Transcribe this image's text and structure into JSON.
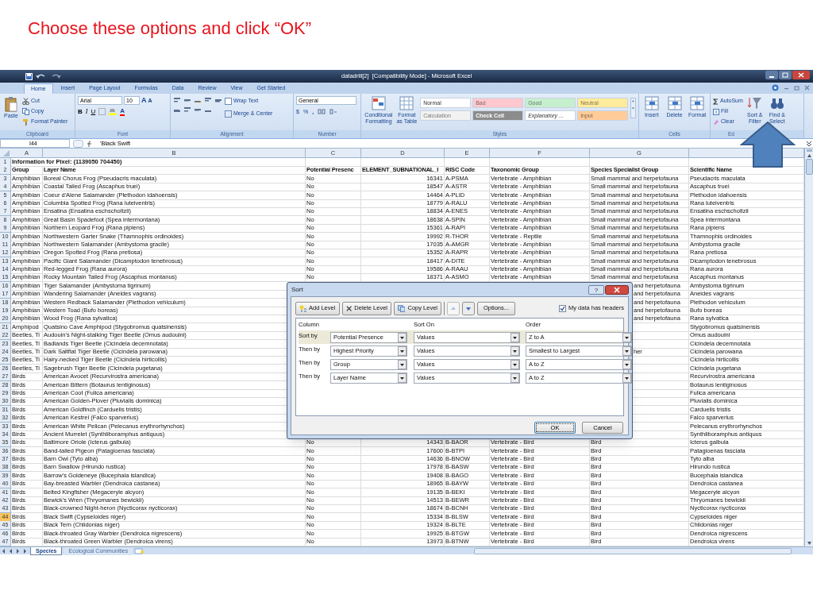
{
  "slide_title": "Choose these options and click “OK”",
  "window": {
    "title": "datadrill[2]  [Compatibility Mode] - Microsoft Excel"
  },
  "ribbon_tabs": [
    {
      "label": "Home",
      "selected": true
    },
    {
      "label": "Insert",
      "selected": false
    },
    {
      "label": "Page Layout",
      "selected": false
    },
    {
      "label": "Formulas",
      "selected": false
    },
    {
      "label": "Data",
      "selected": false
    },
    {
      "label": "Review",
      "selected": false
    },
    {
      "label": "View",
      "selected": false
    },
    {
      "label": "Get Started",
      "selected": false
    }
  ],
  "ribbon": {
    "clipboard": {
      "label": "Clipboard",
      "paste": "Paste",
      "cut": "Cut",
      "copy": "Copy",
      "format_painter": "Format Painter"
    },
    "font": {
      "label": "Font",
      "font_name": "Arial",
      "font_size": "10",
      "grow": "A",
      "shrink": "A",
      "bold": "B",
      "italic": "I",
      "underline": "U",
      "font_color": "A"
    },
    "alignment": {
      "label": "Alignment",
      "wrap_text": "Wrap Text",
      "merge_center": "Merge & Center"
    },
    "number": {
      "label": "Number",
      "format": "General",
      "currency": "$",
      "percent": "%",
      "comma": ","
    },
    "styles": {
      "label": "Styles",
      "conditional_formatting": "Conditional Formatting",
      "format_as_table": "Format as Table",
      "cell_styles": [
        {
          "label": "Normal",
          "color": "#ffffff"
        },
        {
          "label": "Bad",
          "color": "#ffc7ce"
        },
        {
          "label": "Good",
          "color": "#c6efce"
        },
        {
          "label": "Neutral",
          "color": "#ffeb9c"
        },
        {
          "label": "Calculation",
          "color": "#f2f2f2"
        },
        {
          "label": "Check Cell",
          "color": "#8c8c8c"
        },
        {
          "label": "Explanatory ...",
          "color": "#ffffff"
        },
        {
          "label": "Input",
          "color": "#ffcc99"
        }
      ]
    },
    "cells": {
      "label": "Cells",
      "buttons": [
        "Insert",
        "Delete",
        "Format"
      ]
    },
    "editing": {
      "label": "Ed",
      "autosum": "AutoSum",
      "fill": "Fill",
      "clear": "Clear",
      "sort_filter": "Sort & Filter",
      "find_select": "Find & Select"
    }
  },
  "formula_bar": {
    "name_box": "I44",
    "formula": "'Black Swift"
  },
  "sheet": {
    "columns": [
      "A",
      "B",
      "C",
      "D",
      "E",
      "F",
      "G"
    ],
    "rows": [
      {
        "n": "1",
        "kind": "title",
        "selected": false,
        "A": "Information for Pixel: (1139050 704450)"
      },
      {
        "n": "2",
        "kind": "header",
        "selected": false,
        "A": "Group",
        "B": "Layer Name",
        "C": "Potential Presenc",
        "D": "ELEMENT_SUBNATIONAL_I",
        "E": "RISC Code",
        "F": "Taxonomic Group",
        "G": "Species Specialist Group",
        "H": "Scientific Name"
      },
      {
        "n": "3",
        "kind": "data",
        "selected": false,
        "A": "Amphibian",
        "B": "Boreal Chorus Frog (Pseudacris maculata)",
        "C": "No",
        "D": "16341",
        "E": "A-PSMA",
        "F": "Vertebrate - Amphibian",
        "G": "Small mammal and herpetofauna",
        "H": "Pseudacris maculata"
      },
      {
        "n": "4",
        "kind": "data",
        "selected": false,
        "A": "Amphibian",
        "B": "Coastal Tailed Frog (Ascaphus truei)",
        "C": "No",
        "D": "18547",
        "E": "A-ASTR",
        "F": "Vertebrate - Amphibian",
        "G": "Small mammal and herpetofauna",
        "H": "Ascaphus truei"
      },
      {
        "n": "5",
        "kind": "data",
        "selected": false,
        "A": "Amphibian",
        "B": "Coeur d'Alene Salamander (Plethodon idahoensis)",
        "C": "No",
        "D": "14464",
        "E": "A-PLID",
        "F": "Vertebrate - Amphibian",
        "G": "Small mammal and herpetofauna",
        "H": "Plethodon idahoensis"
      },
      {
        "n": "6",
        "kind": "data",
        "selected": false,
        "A": "Amphibian",
        "B": "Columbia Spotted Frog (Rana luteiventris)",
        "C": "No",
        "D": "18779",
        "E": "A-RALU",
        "F": "Vertebrate - Amphibian",
        "G": "Small mammal and herpetofauna",
        "H": "Rana luteiventris"
      },
      {
        "n": "7",
        "kind": "data",
        "selected": false,
        "A": "Amphibian",
        "B": "Ensatina (Ensatina eschscholtzii)",
        "C": "No",
        "D": "18834",
        "E": "A-ENES",
        "F": "Vertebrate - Amphibian",
        "G": "Small mammal and herpetofauna",
        "H": "Ensatina eschscholtzii"
      },
      {
        "n": "8",
        "kind": "data",
        "selected": false,
        "A": "Amphibian",
        "B": "Great Basin Spadefoot (Spea intermontana)",
        "C": "No",
        "D": "18638",
        "E": "A-SPIN",
        "F": "Vertebrate - Amphibian",
        "G": "Small mammal and herpetofauna",
        "H": "Spea intermontana"
      },
      {
        "n": "9",
        "kind": "data",
        "selected": false,
        "A": "Amphibian",
        "B": "Northern Leopard Frog (Rana pipiens)",
        "C": "No",
        "D": "15361",
        "E": "A-RAPI",
        "F": "Vertebrate - Amphibian",
        "G": "Small mammal and herpetofauna",
        "H": "Rana pipiens"
      },
      {
        "n": "10",
        "kind": "data",
        "selected": false,
        "A": "Amphibian",
        "B": "Northwestern Garter Snake (Thamnophis ordinoides)",
        "C": "No",
        "D": "19992",
        "E": "R-THOR",
        "F": "Vertebrate - Reptile",
        "G": "Small mammal and herpetofauna",
        "H": "Thamnophis ordinoides"
      },
      {
        "n": "11",
        "kind": "data",
        "selected": false,
        "A": "Amphibian",
        "B": "Northwestern Salamander (Ambystoma gracile)",
        "C": "No",
        "D": "17035",
        "E": "A-AMGR",
        "F": "Vertebrate - Amphibian",
        "G": "Small mammal and herpetofauna",
        "H": "Ambystoma gracile"
      },
      {
        "n": "12",
        "kind": "data",
        "selected": false,
        "A": "Amphibian",
        "B": "Oregon Spotted Frog (Rana pretiosa)",
        "C": "No",
        "D": "15352",
        "E": "A-RAPR",
        "F": "Vertebrate - Amphibian",
        "G": "Small mammal and herpetofauna",
        "H": "Rana pretiosa"
      },
      {
        "n": "13",
        "kind": "data",
        "selected": false,
        "A": "Amphibian",
        "B": "Pacific Giant Salamander (Dicamptodon tenebrosus)",
        "C": "No",
        "D": "18417",
        "E": "A-DITE",
        "F": "Vertebrate - Amphibian",
        "G": "Small mammal and herpetofauna",
        "H": "Dicamptodon tenebrosus"
      },
      {
        "n": "14",
        "kind": "data",
        "selected": false,
        "A": "Amphibian",
        "B": "Red-legged Frog (Rana aurora)",
        "C": "No",
        "D": "19586",
        "E": "A-RAAU",
        "F": "Vertebrate - Amphibian",
        "G": "Small mammal and herpetofauna",
        "H": "Rana aurora"
      },
      {
        "n": "15",
        "kind": "data",
        "selected": false,
        "A": "Amphibian",
        "B": "Rocky Mountain Tailed Frog (Ascaphus montanus)",
        "C": "No",
        "D": "18371",
        "E": "A-ASMO",
        "F": "Vertebrate - Amphibian",
        "G": "Small mammal and herpetofauna",
        "H": "Ascaphus montanus"
      },
      {
        "n": "16",
        "kind": "data",
        "selected": false,
        "A": "Amphibian",
        "B": "Tiger Salamander (Ambystoma tigrinum)",
        "G": "and herpetofauna",
        "H": "Ambystoma tigrinum"
      },
      {
        "n": "17",
        "kind": "data",
        "selected": false,
        "A": "Amphibian",
        "B": "Wandering Salamander (Aneides vagrans)",
        "G": "and herpetofauna",
        "H": "Aneides vagrans"
      },
      {
        "n": "18",
        "kind": "data",
        "selected": false,
        "A": "Amphibian",
        "B": "Western Redback Salamander (Plethodon vehiculum)",
        "G": "and herpetofauna",
        "H": "Plethodon vehiculum"
      },
      {
        "n": "19",
        "kind": "data",
        "selected": false,
        "A": "Amphibian",
        "B": "Western Toad (Bufo boreas)",
        "G": "and herpetofauna",
        "H": "Bufo boreas"
      },
      {
        "n": "20",
        "kind": "data",
        "selected": false,
        "A": "Amphibian",
        "B": "Wood Frog (Rana sylvatica)",
        "G": "and herpetofauna",
        "H": "Rana sylvatica"
      },
      {
        "n": "21",
        "kind": "data",
        "selected": false,
        "A": "Amphipod",
        "B": "Quatsino Cave Amphipod (Stygobromus quatsinensis)",
        "H": "Stygobromus quatsinensis"
      },
      {
        "n": "22",
        "kind": "data",
        "selected": false,
        "A": "Beetles, Ti",
        "B": "Audouin's Night-stalking Tiger Beetle (Omus audouini)",
        "H": "Omus audouini"
      },
      {
        "n": "23",
        "kind": "data",
        "selected": false,
        "A": "Beetles, Ti",
        "B": "Badlands Tiger Beetle (Cicindela decemnotata)",
        "H": "Cicindela decemnotata"
      },
      {
        "n": "24",
        "kind": "data",
        "selected": false,
        "A": "Beetles, Ti",
        "B": "Dark Saltflat Tiger Beetle (Cicindela parowana)",
        "G": "her",
        "H": "Cicindela parowana"
      },
      {
        "n": "25",
        "kind": "data",
        "selected": false,
        "A": "Beetles, Ti",
        "B": "Hairy-necked Tiger Beetle (Cicindela hirticollis)",
        "H": "Cicindela hirticollis"
      },
      {
        "n": "26",
        "kind": "data",
        "selected": false,
        "A": "Beetles, Ti",
        "B": "Sagebrush Tiger Beetle (Cicindela pugetana)",
        "H": "Cicindela pugetana"
      },
      {
        "n": "27",
        "kind": "data",
        "selected": false,
        "A": "Birds",
        "B": "American Avocet (Recurvirostra americana)",
        "H": "Recurvirostra americana"
      },
      {
        "n": "28",
        "kind": "data",
        "selected": false,
        "A": "Birds",
        "B": "American Bittern (Botaurus lentiginosus)",
        "H": "Botaurus lentiginosus"
      },
      {
        "n": "29",
        "kind": "data",
        "selected": false,
        "A": "Birds",
        "B": "American Coot (Fulica americana)",
        "H": "Fulica americana"
      },
      {
        "n": "30",
        "kind": "data",
        "selected": false,
        "A": "Birds",
        "B": "American Golden-Plover (Pluvialis dominica)",
        "H": "Pluvialis dominica"
      },
      {
        "n": "31",
        "kind": "data",
        "selected": false,
        "A": "Birds",
        "B": "American Goldfinch (Carduelis tristis)",
        "H": "Carduelis tristis"
      },
      {
        "n": "32",
        "kind": "data",
        "selected": false,
        "A": "Birds",
        "B": "American Kestrel (Falco sparverius)",
        "H": "Falco sparverius"
      },
      {
        "n": "33",
        "kind": "data",
        "selected": false,
        "A": "Birds",
        "B": "American White Pelican (Pelecanus erythrorhynchos)",
        "H": "Pelecanus erythrorhynchos"
      },
      {
        "n": "34",
        "kind": "data",
        "selected": false,
        "A": "Birds",
        "B": "Ancient Murrelet (Synthliboramphus antiquus)",
        "H": "Synthliboramphus antiquus"
      },
      {
        "n": "35",
        "kind": "data",
        "selected": false,
        "A": "Birds",
        "B": "Baltimore Oriole (Icterus galbula)",
        "C": "No",
        "D": "14343",
        "E": "B-BAOR",
        "F": "Vertebrate - Bird",
        "G": "Bird",
        "H": "Icterus galbula"
      },
      {
        "n": "36",
        "kind": "data",
        "selected": false,
        "A": "Birds",
        "B": "Band-tailed Pigeon (Patagioenas fasciata)",
        "C": "No",
        "D": "17600",
        "E": "B-BTPI",
        "F": "Vertebrate - Bird",
        "G": "Bird",
        "H": "Patagioenas fasciata"
      },
      {
        "n": "37",
        "kind": "data",
        "selected": false,
        "A": "Birds",
        "B": "Barn Owl (Tyto alba)",
        "C": "No",
        "D": "14636",
        "E": "B-BNOW",
        "F": "Vertebrate - Bird",
        "G": "Bird",
        "H": "Tyto alba"
      },
      {
        "n": "38",
        "kind": "data",
        "selected": false,
        "A": "Birds",
        "B": "Barn Swallow (Hirundo rustica)",
        "C": "No",
        "D": "17978",
        "E": "B-BASW",
        "F": "Vertebrate - Bird",
        "G": "Bird",
        "H": "Hirundo rustica"
      },
      {
        "n": "39",
        "kind": "data",
        "selected": false,
        "A": "Birds",
        "B": "Barrow's Goldeneye (Bucephala islandica)",
        "C": "No",
        "D": "19408",
        "E": "B-BAGO",
        "F": "Vertebrate - Bird",
        "G": "Bird",
        "H": "Bucephala islandica"
      },
      {
        "n": "40",
        "kind": "data",
        "selected": false,
        "A": "Birds",
        "B": "Bay-breasted Warbler (Dendroica castanea)",
        "C": "No",
        "D": "18965",
        "E": "B-BAYW",
        "F": "Vertebrate - Bird",
        "G": "Bird",
        "H": "Dendroica castanea"
      },
      {
        "n": "41",
        "kind": "data",
        "selected": false,
        "A": "Birds",
        "B": "Belted Kingfisher (Megaceryle alcyon)",
        "C": "No",
        "D": "19135",
        "E": "B-BEKI",
        "F": "Vertebrate - Bird",
        "G": "Bird",
        "H": "Megaceryle alcyon"
      },
      {
        "n": "42",
        "kind": "data",
        "selected": false,
        "A": "Birds",
        "B": "Bewick's Wren (Thryomanes bewickii)",
        "C": "No",
        "D": "14513",
        "E": "B-BEWR",
        "F": "Vertebrate - Bird",
        "G": "Bird",
        "H": "Thryomanes bewickii"
      },
      {
        "n": "43",
        "kind": "data",
        "selected": false,
        "A": "Birds",
        "B": "Black-crowned Night-heron (Nycticorax nycticorax)",
        "C": "No",
        "D": "18674",
        "E": "B-BCNH",
        "F": "Vertebrate - Bird",
        "G": "Bird",
        "H": "Nycticorax nycticorax"
      },
      {
        "n": "44",
        "kind": "data",
        "selected": true,
        "A": "Birds",
        "B": "Black Swift (Cypseloides niger)",
        "C": "No",
        "D": "15334",
        "E": "B-BLSW",
        "F": "Vertebrate - Bird",
        "G": "Bird",
        "H": "Cypseloides niger"
      },
      {
        "n": "45",
        "kind": "data",
        "selected": false,
        "A": "Birds",
        "B": "Black Tern (Chlidonias niger)",
        "C": "No",
        "D": "19324",
        "E": "B-BLTE",
        "F": "Vertebrate - Bird",
        "G": "Bird",
        "H": "Chlidonias niger"
      },
      {
        "n": "46",
        "kind": "data",
        "selected": false,
        "A": "Birds",
        "B": "Black-throated Gray Warbler (Dendroica nigrescens)",
        "C": "No",
        "D": "19925",
        "E": "B-BTGW",
        "F": "Vertebrate - Bird",
        "G": "Bird",
        "H": "Dendroica nigrescens"
      },
      {
        "n": "47",
        "kind": "data",
        "selected": false,
        "A": "Birds",
        "B": "Black-throated Green Warbler (Dendroica virens)",
        "C": "No",
        "D": "13973",
        "E": "B-BTNW",
        "F": "Vertebrate - Bird",
        "G": "Bird",
        "H": "Dendroica virens"
      }
    ]
  },
  "sheet_tabs": [
    {
      "label": "Species",
      "selected": true
    },
    {
      "label": "Ecological Communities",
      "selected": false
    }
  ],
  "sort_dialog": {
    "title": "Sort",
    "help": "?",
    "buttons": [
      "Add Level",
      "Delete Level",
      "Copy Level"
    ],
    "options": "Options...",
    "headers_checkbox": {
      "label": "My data has headers",
      "checked": true
    },
    "columns": [
      "Column",
      "Sort On",
      "Order"
    ],
    "levels": [
      {
        "label": "Sort by",
        "column": "Potential Presence",
        "sort_on": "Values",
        "order": "Z to A",
        "selected": true
      },
      {
        "label": "Then by",
        "column": "Highest Priority",
        "sort_on": "Values",
        "order": "Smallest to Largest",
        "selected": false
      },
      {
        "label": "Then by",
        "column": "Group",
        "sort_on": "Values",
        "order": "A to Z",
        "selected": false
      },
      {
        "label": "Then by",
        "column": "Layer Name",
        "sort_on": "Values",
        "order": "A to Z",
        "selected": false
      }
    ],
    "ok": "OK",
    "cancel": "Cancel"
  }
}
